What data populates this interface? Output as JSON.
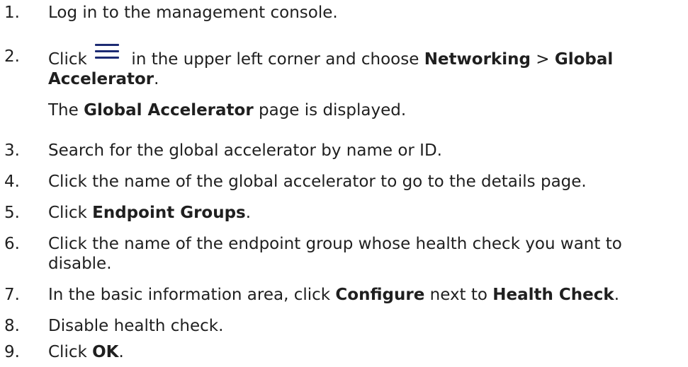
{
  "steps": [
    {
      "number": "1.",
      "segments": [
        {
          "text": "Log in to the management console."
        }
      ]
    },
    {
      "number": "2.",
      "icon": "menu-icon",
      "line1": [
        {
          "text": "Click "
        },
        {
          "icon": "menu-icon"
        },
        {
          "text": " in the upper left corner and choose "
        },
        {
          "text": "Networking",
          "bold": true
        },
        {
          "text": " > "
        },
        {
          "text": "Global",
          "bold": true
        }
      ],
      "line2": [
        {
          "text": "Accelerator",
          "bold": true
        },
        {
          "text": "."
        }
      ],
      "sub": [
        {
          "text": "The "
        },
        {
          "text": "Global Accelerator",
          "bold": true
        },
        {
          "text": " page is displayed."
        }
      ]
    },
    {
      "number": "3.",
      "segments": [
        {
          "text": "Search for the global accelerator by name or ID."
        }
      ]
    },
    {
      "number": "4.",
      "segments": [
        {
          "text": "Click the name of the global accelerator to go to the details page."
        }
      ]
    },
    {
      "number": "5.",
      "segments": [
        {
          "text": "Click "
        },
        {
          "text": "Endpoint Groups",
          "bold": true
        },
        {
          "text": "."
        }
      ]
    },
    {
      "number": "6.",
      "line1": [
        {
          "text": "Click the name of the endpoint group whose health check you want to"
        }
      ],
      "line2": [
        {
          "text": "disable."
        }
      ]
    },
    {
      "number": "7.",
      "segments": [
        {
          "text": "In the basic information area, click "
        },
        {
          "text": "Configure",
          "bold": true
        },
        {
          "text": " next to "
        },
        {
          "text": "Health Check",
          "bold": true
        },
        {
          "text": "."
        }
      ]
    },
    {
      "number": "8.",
      "segments": [
        {
          "text": "Disable health check."
        }
      ]
    },
    {
      "number": "9.",
      "segments": [
        {
          "text": "Click "
        },
        {
          "text": "OK",
          "bold": true
        },
        {
          "text": "."
        }
      ]
    }
  ],
  "colors": {
    "text": "#1f1f1f",
    "icon": "#1d2b73",
    "background": "#ffffff"
  }
}
